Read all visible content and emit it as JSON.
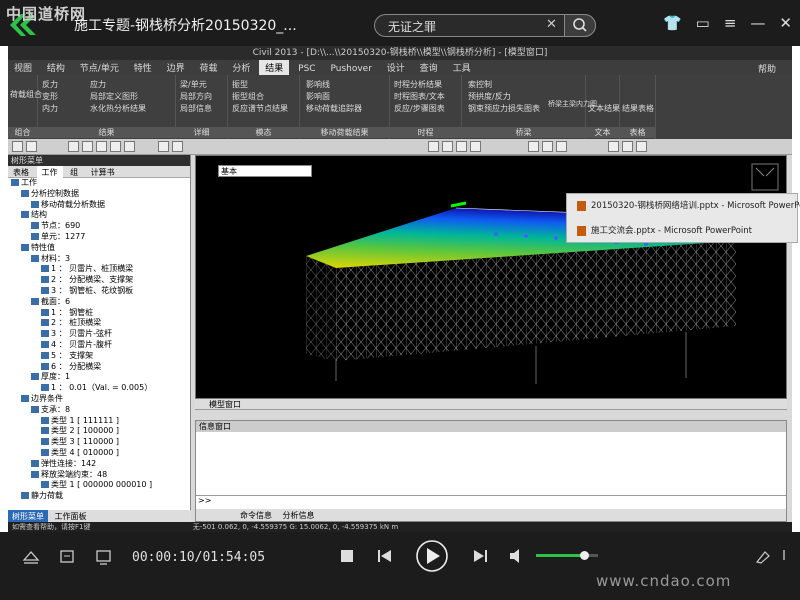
{
  "player": {
    "watermark_top": "中国道桥网",
    "title": "施工专题-钢栈桥分析20150320_...",
    "search_value": "无证之罪",
    "time": "00:00:10/01:54:05",
    "watermark_bottom": "www.cndao.com",
    "volume_fraction": 0.78,
    "icons": [
      "shirt-icon",
      "chat-icon",
      "menu-icon",
      "minimize-icon",
      "close-icon"
    ],
    "controls": [
      "eject-icon",
      "playlist-icon",
      "screen-icon",
      "stop-icon",
      "prev-icon",
      "play-icon",
      "next-icon",
      "volume-icon",
      "snapshot-icon",
      "fullscreen-icon"
    ]
  },
  "app": {
    "window_title": "Civil 2013 - [D:\\\\...\\\\20150320-钢栈桥\\\\模型\\\\钢栈桥分析] - [模型窗口]",
    "menus": [
      "视图",
      "结构",
      "节点/单元",
      "特性",
      "边界",
      "荷载",
      "分析",
      "结果",
      "PSC",
      "Pushover",
      "设计",
      "查询",
      "工具"
    ],
    "active_menu": "结果",
    "help": "帮助",
    "ribbon_groups": [
      {
        "label": "组合",
        "items": [
          "荷载组合"
        ]
      },
      {
        "label": "结果",
        "items": [
          "反力",
          "变形",
          "内力",
          "应力",
          "局部定义图形",
          "水化热分析结果"
        ]
      },
      {
        "label": "详细",
        "items": [
          "梁/单元",
          "局部方向",
          "局部信息"
        ]
      },
      {
        "label": "模态",
        "items": [
          "振型",
          "振型组合",
          "反应谱节点结果"
        ]
      },
      {
        "label": "移动荷载结果",
        "items": [
          "影响线",
          "影响面",
          "移动荷载追踪器"
        ]
      },
      {
        "label": "时程",
        "items": [
          "时程分析结果",
          "时程图表/文本",
          "反应/步骤图表"
        ]
      },
      {
        "label": "桥梁",
        "items": [
          "索控制",
          "预拱度/反力",
          "钢束预应力损失图表",
          "桥梁主梁内力图"
        ]
      },
      {
        "label": "文本",
        "items": [
          "文本结果"
        ]
      },
      {
        "label": "表格",
        "items": [
          "结果表格"
        ]
      }
    ],
    "tree": {
      "header": "树形菜单",
      "tabs": [
        "表格",
        "工作",
        "组",
        "计算书"
      ],
      "active_tab": "工作",
      "nodes": [
        "工作",
        "分析控制数据",
        "移动荷载分析数据",
        "结构",
        "节点：690",
        "单元：1277",
        "特性值",
        "材料：3",
        "1 ： 贝雷片、桩顶横梁",
        "2 ： 分配横梁、支撑架",
        "3 ： 钢管桩、花纹钢板",
        "截面：6",
        "1 ： 钢管桩",
        "2 ： 桩顶横梁",
        "3 ： 贝雷片-弦杆",
        "4 ： 贝雷片-腹杆",
        "5 ： 支撑架",
        "6 ： 分配横梁",
        "厚度：1",
        "1 ： 0.01（Val. = 0.005）",
        "边界条件",
        "支承：8",
        "类型 1 [ 111111 ]",
        "类型 2 [ 100000 ]",
        "类型 3 [ 110000 ]",
        "类型 4 [ 010000 ]",
        "弹性连接：142",
        "释放梁端约束：48",
        "类型 1 [ 000000 000010 ]",
        "静力荷载"
      ],
      "bottom_tabs": [
        "树形菜单",
        "工作面板"
      ],
      "status_help": "如需查看帮助，请按F1键"
    },
    "model": {
      "view_combo": "基本",
      "tab": "模型窗口"
    },
    "info": {
      "header": "信息窗口",
      "prompt": ">>",
      "tabs": [
        "命令信息",
        "分析信息"
      ]
    },
    "status": "无-501    0.062, 0, -4.559375    G: 15.0062, 0, -4.559375    kN    m"
  },
  "popup": {
    "items": [
      "20150320-钢栈桥网络培训.pptx - Microsoft PowerPoint",
      "施工交流会.pptx - Microsoft PowerPoint"
    ]
  }
}
